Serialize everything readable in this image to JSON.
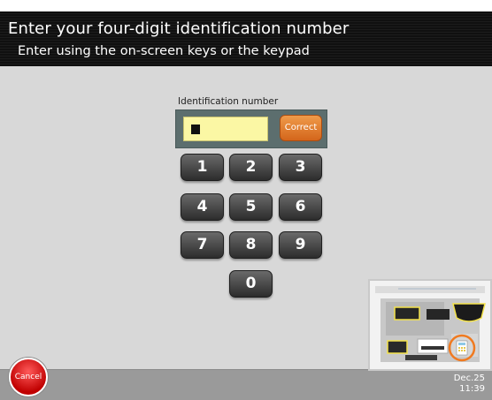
{
  "header": {
    "title": "Enter your four-digit identification number",
    "subtitle": "Enter using the on-screen keys or the keypad"
  },
  "id_entry": {
    "label": "Identification number",
    "value": "",
    "correct_label": "Correct"
  },
  "keypad": {
    "keys": [
      "1",
      "2",
      "3",
      "4",
      "5",
      "6",
      "7",
      "8",
      "9",
      "0"
    ]
  },
  "footer": {
    "cancel_label": "Cancel",
    "date": "Dec.25",
    "time": "11:39"
  },
  "colors": {
    "header_bg": "#141414",
    "background": "#d8d8d8",
    "input_bg": "#fbf7a4",
    "correct_button": "#e07828",
    "cancel_button": "#d00000"
  },
  "icons": {
    "device_illustration": "printer-device-illustration-icon"
  }
}
